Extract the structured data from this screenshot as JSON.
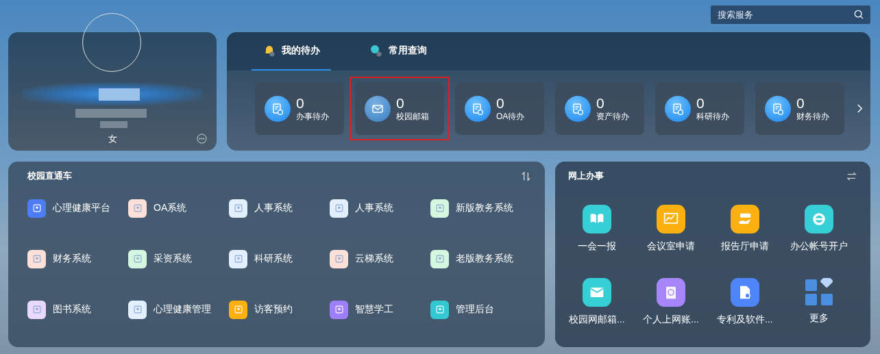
{
  "search": {
    "placeholder": "搜索服务"
  },
  "profile": {
    "gender": "女"
  },
  "todo": {
    "tabs": [
      {
        "label": "我的待办",
        "selected": true,
        "kind": "bell"
      },
      {
        "label": "常用查询",
        "selected": false,
        "kind": "search"
      }
    ],
    "items": [
      {
        "count": "0",
        "label": "办事待办",
        "kind": "doc",
        "highlighted": false
      },
      {
        "count": "0",
        "label": "校园邮箱",
        "kind": "mail",
        "highlighted": true
      },
      {
        "count": "0",
        "label": "OA待办",
        "kind": "doc",
        "highlighted": false
      },
      {
        "count": "0",
        "label": "资产待办",
        "kind": "doc",
        "highlighted": false
      },
      {
        "count": "0",
        "label": "科研待办",
        "kind": "doc",
        "highlighted": false
      },
      {
        "count": "0",
        "label": "财务待办",
        "kind": "doc",
        "highlighted": false
      }
    ]
  },
  "shortcuts": {
    "title": "校园直通车",
    "items": [
      {
        "label": "心理健康平台",
        "color": "#4e7cf6",
        "solid": true
      },
      {
        "label": "OA系统",
        "color": "#fde0d8",
        "solid": false
      },
      {
        "label": "人事系统",
        "color": "#e4effd",
        "solid": false
      },
      {
        "label": "人事系统",
        "color": "#e4effd",
        "solid": false
      },
      {
        "label": "新版教务系统",
        "color": "#d6f7df",
        "solid": false
      },
      {
        "label": "财务系统",
        "color": "#fde0d8",
        "solid": false
      },
      {
        "label": "采资系统",
        "color": "#d6f7df",
        "solid": false
      },
      {
        "label": "科研系统",
        "color": "#e4effd",
        "solid": false
      },
      {
        "label": "云梯系统",
        "color": "#fde0d8",
        "solid": false
      },
      {
        "label": "老版教务系统",
        "color": "#d6f7df",
        "solid": false
      },
      {
        "label": "图书系统",
        "color": "#e8d8fb",
        "solid": false
      },
      {
        "label": "心理健康管理",
        "color": "#e4effd",
        "solid": false
      },
      {
        "label": "访客预约",
        "color": "#fbb012",
        "solid": true
      },
      {
        "label": "智慧学工",
        "color": "#9d7ff7",
        "solid": true
      },
      {
        "label": "管理后台",
        "color": "#33c9d2",
        "solid": true
      }
    ]
  },
  "services": {
    "title": "网上办事",
    "items": [
      {
        "label": "一会一报",
        "color": "#36cfd6",
        "kind": "book"
      },
      {
        "label": "会议室申请",
        "color": "#fbb012",
        "kind": "chart"
      },
      {
        "label": "报告厅申请",
        "color": "#fbb012",
        "kind": "hand"
      },
      {
        "label": "办公帐号开户",
        "color": "#36cfd6",
        "kind": "browser"
      },
      {
        "label": "校园网邮箱...",
        "color": "#36cfd6",
        "kind": "mail"
      },
      {
        "label": "个人上网账...",
        "color": "#a686f8",
        "kind": "globe"
      },
      {
        "label": "专利及软件...",
        "color": "#4f86f7",
        "kind": "doc"
      },
      {
        "label": "更多",
        "color": "#4a8fe0",
        "kind": "more"
      }
    ]
  }
}
